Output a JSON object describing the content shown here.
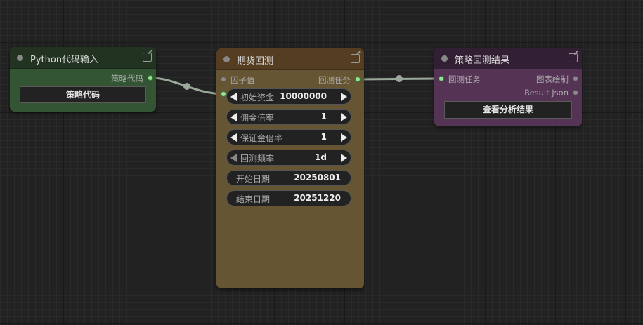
{
  "colors": {
    "canvas_bg": "#222222",
    "link": "#9aa89a",
    "python_node_body": "#335533",
    "python_node_header": "#223322",
    "backtest_node_body": "#665533",
    "backtest_node_header": "#553d22",
    "result_node_body": "#553355",
    "result_node_header": "#331f33",
    "connected_slot": "#8fe88f",
    "empty_slot": "#8a8a8a"
  },
  "python_node": {
    "title": "Python代码输入",
    "output_label": "策略代码",
    "button_label": "策略代码",
    "icons": [
      "collapse-dot-icon",
      "edit-icon"
    ]
  },
  "backtest_node": {
    "title": "期货回测",
    "input_factor_label": "因子值",
    "output_task_label": "回测任务",
    "widgets": [
      {
        "name": "初始资金",
        "value": "10000000"
      },
      {
        "name": "佣金倍率",
        "value": "1"
      },
      {
        "name": "保证金倍率",
        "value": "1"
      },
      {
        "name": "回测频率",
        "value": "1d"
      },
      {
        "name": "开始日期",
        "value": "20250801"
      },
      {
        "name": "结束日期",
        "value": "20251220"
      }
    ]
  },
  "result_node": {
    "title": "策略回测结果",
    "input_label": "回测任务",
    "output_chart_label": "图表绘制",
    "output_json_label": "Result Json",
    "button_label": "查看分析结果"
  }
}
